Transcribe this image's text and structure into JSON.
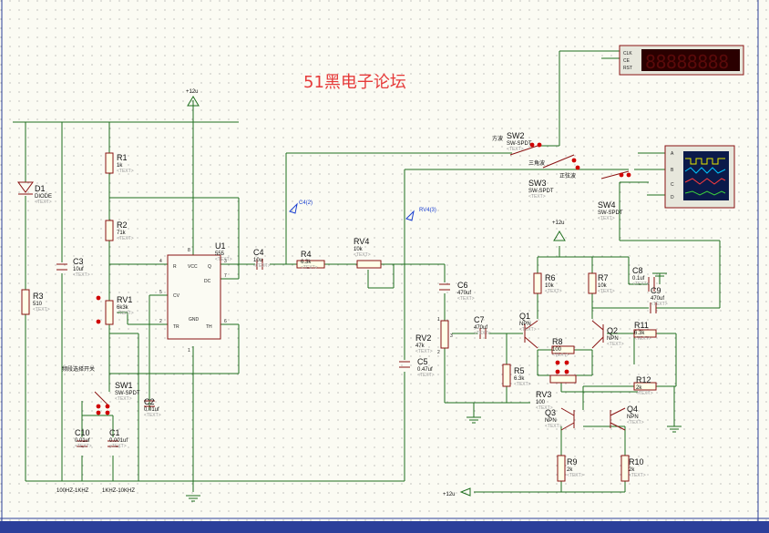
{
  "colors": {
    "canvas": "#fbfbf3",
    "wire": "#1f6f1f",
    "component": "#8a1313",
    "title": "#e63a3a",
    "probe": "#1a3fd0",
    "status_bar": "#2b3f9a"
  },
  "title": "51黑电子论坛",
  "rails": {
    "vcc_top": "+12u",
    "vcc_mid": "+12u",
    "vcc_bottom": "+12u"
  },
  "components": [
    {
      "ref": "D1",
      "value": "DIODE",
      "text": "<TEXT>"
    },
    {
      "ref": "R3",
      "value": "510",
      "text": "<TEXT>"
    },
    {
      "ref": "C3",
      "value": "10uf",
      "text": "<TEXT>"
    },
    {
      "ref": "R1",
      "value": "1k",
      "text": "<TEXT>"
    },
    {
      "ref": "R2",
      "value": "71k",
      "text": "<TEXT>"
    },
    {
      "ref": "RV1",
      "value": "6k3k",
      "text": "<TEXT>"
    },
    {
      "ref": "U1",
      "value": "555",
      "text": "<TEXT>"
    },
    {
      "ref": "C4",
      "value": "10u",
      "text": "<TEXT>"
    },
    {
      "ref": "R4",
      "value": "6.3k",
      "text": "<TEXT>"
    },
    {
      "ref": "RV4",
      "value": "10k",
      "text": "<TEXT>"
    },
    {
      "ref": "C5",
      "value": "0.47uf",
      "text": "<TEXT>"
    },
    {
      "ref": "SW1",
      "value": "SW-SPDT",
      "text": "<TEXT>"
    },
    {
      "ref": "C2",
      "value": "0.01uf",
      "text": "<TEXT>"
    },
    {
      "ref": "C10",
      "value": "0.01uf",
      "text": "<TEXT>"
    },
    {
      "ref": "C1",
      "value": "0.001uf",
      "text": "<TEXT>"
    },
    {
      "ref": "C6",
      "value": "470uf",
      "text": "<TEXT>"
    },
    {
      "ref": "RV2",
      "value": "47k",
      "text": "<TEXT>"
    },
    {
      "ref": "C7",
      "value": "470uf",
      "text": "<TEXT>"
    },
    {
      "ref": "R5",
      "value": "6.3k",
      "text": "<TEXT>"
    },
    {
      "ref": "Q1",
      "value": "NPN",
      "text": "<TEXT>"
    },
    {
      "ref": "R6",
      "value": "10k",
      "text": "<TEXT>"
    },
    {
      "ref": "R7",
      "value": "10k",
      "text": "<TEXT>"
    },
    {
      "ref": "R8",
      "value": "100",
      "text": "<TEXT>"
    },
    {
      "ref": "RV3",
      "value": "100",
      "text": "<TEXT>"
    },
    {
      "ref": "Q2",
      "value": "NPN",
      "text": "<TEXT>"
    },
    {
      "ref": "C8",
      "value": "0.1uf",
      "text": "<TEXT>"
    },
    {
      "ref": "C9",
      "value": "470uf",
      "text": "<TEXT>"
    },
    {
      "ref": "R11",
      "value": "6.3k",
      "text": "<TEXT>"
    },
    {
      "ref": "R12",
      "value": "2k",
      "text": "<TEXT>"
    },
    {
      "ref": "Q3",
      "value": "NPN",
      "text": "<TEXT>"
    },
    {
      "ref": "Q4",
      "value": "NPN",
      "text": "<TEXT>"
    },
    {
      "ref": "R9",
      "value": "2k",
      "text": "<TEXT>"
    },
    {
      "ref": "R10",
      "value": "2k",
      "text": "<TEXT>"
    },
    {
      "ref": "SW2",
      "value": "SW-SPDT",
      "text": "<TEXT>"
    },
    {
      "ref": "SW3",
      "value": "SW-SPDT",
      "text": "<TEXT>"
    },
    {
      "ref": "SW4",
      "value": "SW-SPDT",
      "text": "<TEXT>"
    }
  ],
  "ic555": {
    "pins": {
      "r": "R",
      "vcc": "VCC",
      "q": "Q",
      "dc": "DC",
      "cv": "CV",
      "gnd": "GND",
      "tr": "TR",
      "th": "TH"
    },
    "pin_numbers": {
      "p4": "4",
      "p8": "8",
      "p3": "3",
      "p7": "7",
      "p5": "5",
      "p2": "2",
      "p6": "6",
      "p1": "1"
    }
  },
  "labels": {
    "freq_switch": "频段选择开关",
    "range_low": "100HZ-1KHZ",
    "range_high": "1KHZ-10KHZ",
    "sw2_label": "方波",
    "sw3_label_a": "三角波",
    "sw3_label_b": "正弦波",
    "probe_c4": "C4(2)",
    "probe_rv4": "RV4(3)",
    "rv2_pin1": "1",
    "rv2_pin2": "2",
    "rv2_pin3": "3"
  },
  "counter": {
    "pins": [
      "CLK",
      "CE",
      "RST"
    ],
    "display": "88888888"
  },
  "scope": {
    "channels": [
      "A",
      "B",
      "C",
      "D"
    ]
  }
}
